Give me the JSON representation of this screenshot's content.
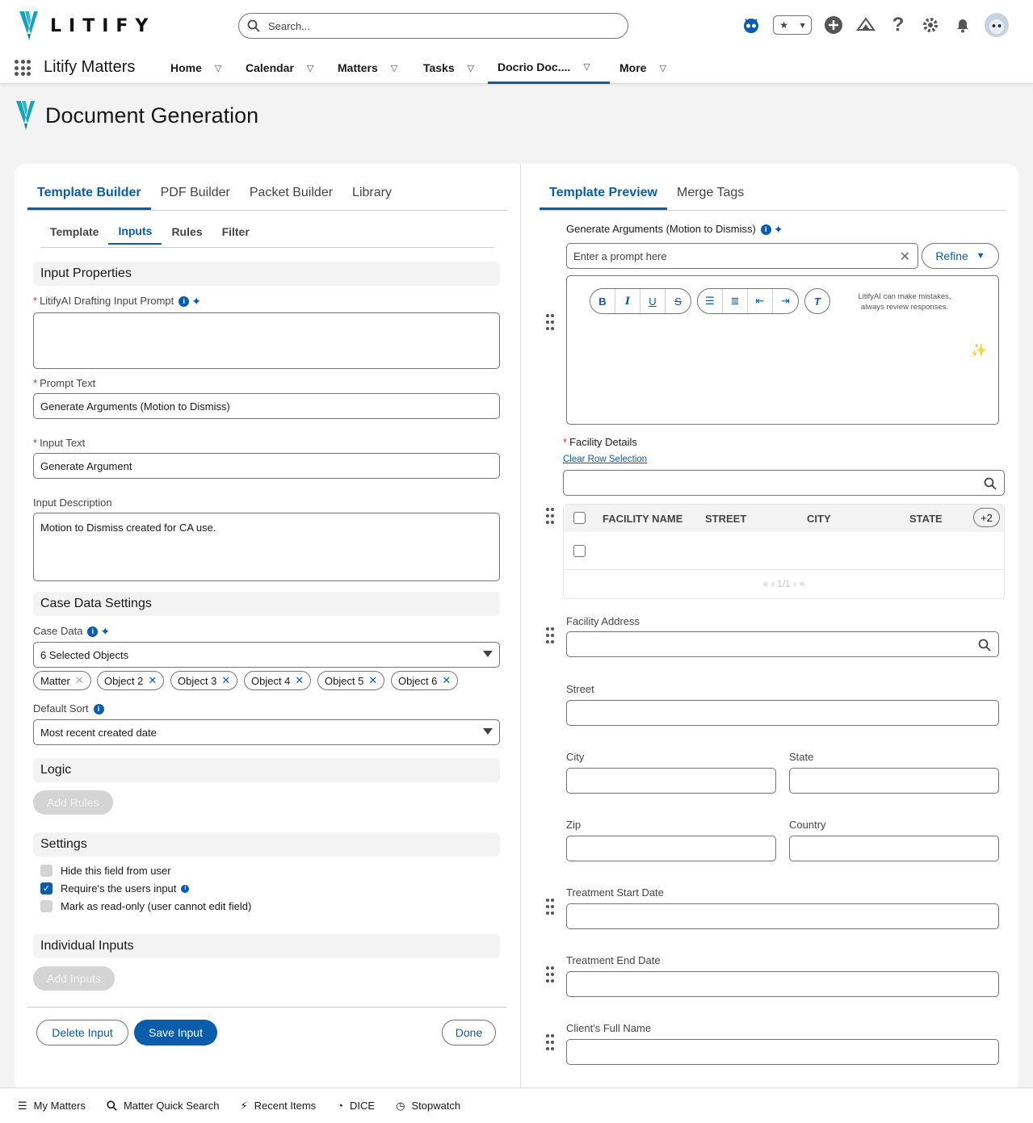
{
  "header": {
    "brand": "LITIFY",
    "search_placeholder": "Search..."
  },
  "nav": {
    "app_name": "Litify Matters",
    "items": [
      {
        "label": "Home"
      },
      {
        "label": "Calendar"
      },
      {
        "label": "Matters"
      },
      {
        "label": "Tasks"
      },
      {
        "label": "Docrio Doc...."
      },
      {
        "label": "More"
      }
    ]
  },
  "page": {
    "title": "Document Generation"
  },
  "left": {
    "tabs": [
      "Template Builder",
      "PDF Builder",
      "Packet Builder",
      "Library"
    ],
    "subtabs": [
      "Template",
      "Inputs",
      "Rules",
      "Filter"
    ],
    "input_properties": "Input Properties",
    "drafting_prompt_label": "LitifyAI Drafting Input Prompt",
    "drafting_prompt_value": "",
    "prompt_text_label": "Prompt Text",
    "prompt_text_value": "Generate Arguments (Motion to Dismiss)",
    "input_text_label": "Input Text",
    "input_text_value": "Generate Argument",
    "input_desc_label": "Input Description",
    "input_desc_value": "Motion to Dismiss created for CA use.",
    "case_data_settings": "Case Data Settings",
    "case_data_label": "Case Data",
    "case_data_value": "6 Selected Objects",
    "pills": [
      "Matter",
      "Object 2",
      "Object 3",
      "Object 4",
      "Object 5",
      "Object 6"
    ],
    "default_sort_label": "Default Sort",
    "default_sort_value": "Most recent created date",
    "logic": "Logic",
    "add_rules": "Add Rules",
    "settings": "Settings",
    "hide_field": "Hide this field from user",
    "require_input": "Require's the users input",
    "read_only": "Mark as read-only (user cannot edit field)",
    "individual_inputs": "Individual Inputs",
    "add_inputs": "Add Inputs",
    "delete_input": "Delete Input",
    "save_input": "Save Input",
    "done": "Done"
  },
  "right": {
    "tabs": [
      "Template Preview",
      "Merge Tags"
    ],
    "gen_args_label": "Generate Arguments (Motion to Dismiss)",
    "prompt_placeholder": "Enter a prompt here",
    "refine": "Refine",
    "ai_disclaimer": "LitifyAI can make mistakes, always review responses.",
    "facility_details": "Facility Details",
    "clear_row": "Clear Row Selection",
    "columns": [
      "FACILITY NAME",
      "STREET",
      "CITY",
      "STATE"
    ],
    "more_cols": "+2",
    "pagination": "« ‹ 1/1 › »",
    "facility_address": "Facility Address",
    "street": "Street",
    "city": "City",
    "state": "State",
    "zip": "Zip",
    "country": "Country",
    "treat_start": "Treatment Start Date",
    "treat_end": "Treatment End Date",
    "client_name": "Client's Full Name"
  },
  "footer": {
    "items": [
      "My Matters",
      "Matter Quick Search",
      "Recent Items",
      "DICE",
      "Stopwatch"
    ]
  },
  "colors": {
    "brand": "#0b5cab",
    "logo": "#1aa3b8"
  }
}
